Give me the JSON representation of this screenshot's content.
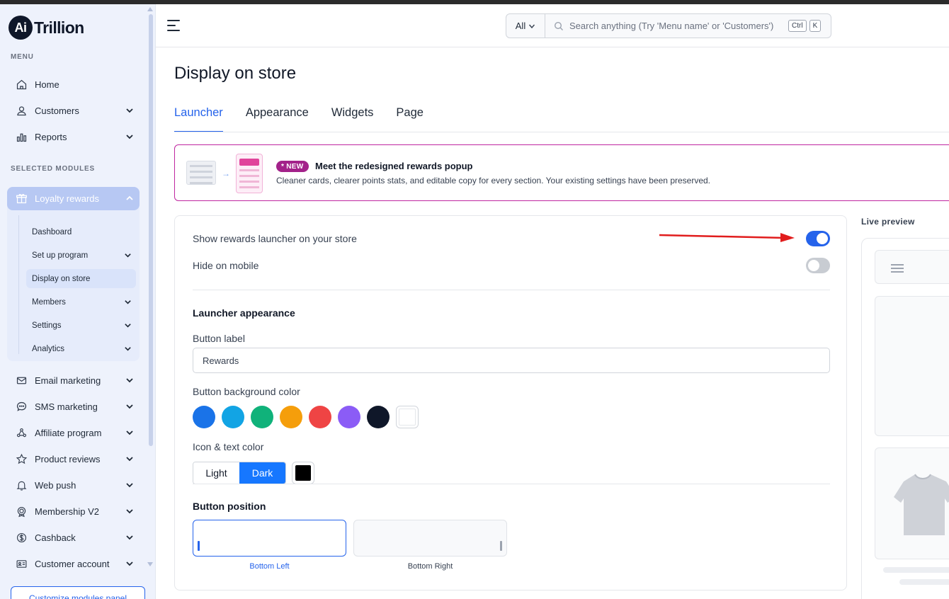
{
  "brand": {
    "badge": "Ai",
    "name": "Trillion"
  },
  "sidebar": {
    "menu_label": "MENU",
    "menu_items": [
      {
        "label": "Home",
        "icon": "home-icon"
      },
      {
        "label": "Customers",
        "icon": "user-icon"
      },
      {
        "label": "Reports",
        "icon": "bar-chart-icon"
      }
    ],
    "modules_label": "SELECTED MODULES",
    "module": {
      "label": "Loyalty rewards",
      "icon": "gift-icon",
      "items": [
        {
          "label": "Dashboard"
        },
        {
          "label": "Set up program"
        },
        {
          "label": "Display on store",
          "active": true
        },
        {
          "label": "Members"
        },
        {
          "label": "Settings"
        },
        {
          "label": "Analytics"
        }
      ]
    },
    "other_modules": [
      {
        "label": "Email marketing",
        "icon": "mail-icon"
      },
      {
        "label": "SMS marketing",
        "icon": "chat-icon"
      },
      {
        "label": "Affiliate program",
        "icon": "network-icon"
      },
      {
        "label": "Product reviews",
        "icon": "star-icon"
      },
      {
        "label": "Web push",
        "icon": "bell-icon"
      },
      {
        "label": "Membership V2",
        "icon": "badge-icon"
      },
      {
        "label": "Cashback",
        "icon": "dollar-icon"
      },
      {
        "label": "Customer account",
        "icon": "id-card-icon"
      }
    ],
    "customize_button": "Customize modules panel"
  },
  "topbar": {
    "search_scope": "All",
    "search_placeholder": "Search anything (Try 'Menu name' or 'Customers')",
    "kbd1": "Ctrl",
    "kbd2": "K"
  },
  "page": {
    "title": "Display on store",
    "tabs": [
      {
        "label": "Launcher",
        "active": true
      },
      {
        "label": "Appearance"
      },
      {
        "label": "Widgets"
      },
      {
        "label": "Page"
      }
    ]
  },
  "banner": {
    "badge": "* NEW",
    "title": "Meet the redesigned rewards popup",
    "subtitle": "Cleaner cards, clearer points stats, and editable copy for every section. Your existing settings have been preserved."
  },
  "settings": {
    "show_launcher_label": "Show rewards launcher on your store",
    "show_launcher_on": true,
    "hide_mobile_label": "Hide on mobile",
    "hide_mobile_on": false,
    "appearance_title": "Launcher appearance",
    "button_label_title": "Button label",
    "button_label_value": "Rewards",
    "bg_color_title": "Button background color",
    "bg_colors": [
      "#1a73e8",
      "#12a4e4",
      "#10b27a",
      "#f59e0b",
      "#ef4444",
      "#8b5cf6",
      "#0f1729"
    ],
    "icon_text_title": "Icon & text color",
    "icon_text_options": [
      "Light",
      "Dark"
    ],
    "icon_text_selected": "Dark",
    "icon_text_swatch": "#000000",
    "position_title": "Button position",
    "positions": [
      {
        "label": "Bottom Left",
        "selected": true
      },
      {
        "label": "Bottom Right",
        "selected": false
      }
    ]
  },
  "preview": {
    "title": "Live preview"
  },
  "colors": {
    "accent": "#2563eb",
    "banner_border": "#c026a0",
    "annotation": "#e11d1d"
  }
}
